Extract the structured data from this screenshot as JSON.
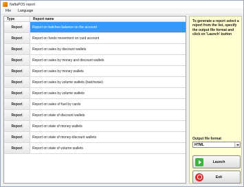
{
  "window": {
    "title": "NaftaPOS report"
  },
  "menu": [
    "File",
    "Language"
  ],
  "table": {
    "columns": {
      "type": "Type",
      "name": "Report name"
    },
    "rows": [
      {
        "type": "Report",
        "name": "Report on batches balance on the account",
        "selected": true
      },
      {
        "type": "Report",
        "name": "Report on funds movement on card account"
      },
      {
        "type": "Report",
        "name": "Report on sales by discount wallets"
      },
      {
        "type": "Report",
        "name": "Report on sales by money and discount wallets"
      },
      {
        "type": "Report",
        "name": "Report on sales by money wallets"
      },
      {
        "type": "Report",
        "name": "Report on sales by volume wallets (batchwise)"
      },
      {
        "type": "Report",
        "name": "Report on sales by volume wallets"
      },
      {
        "type": "Report",
        "name": "Report on sales of fuel by cards"
      },
      {
        "type": "Report",
        "name": "Report on state of discount wallets"
      },
      {
        "type": "Report",
        "name": "Report on state of money wallets"
      },
      {
        "type": "Report",
        "name": "Report on state of money-discount wallets"
      },
      {
        "type": "Report",
        "name": "Report on state of volume wallets"
      }
    ]
  },
  "side_panel": {
    "instructions": "To generate a report select a report from the list, specify the output file format and click on 'Launch' button",
    "format_label": "Output file format",
    "format_value": "HTML",
    "launch_label": "Launch",
    "exit_label": "Exit",
    "icons": {
      "launch": "play-icon",
      "exit": "power-icon"
    }
  },
  "colors": {
    "selection": "#3399ff",
    "panel_bg": "#ffffd2"
  }
}
